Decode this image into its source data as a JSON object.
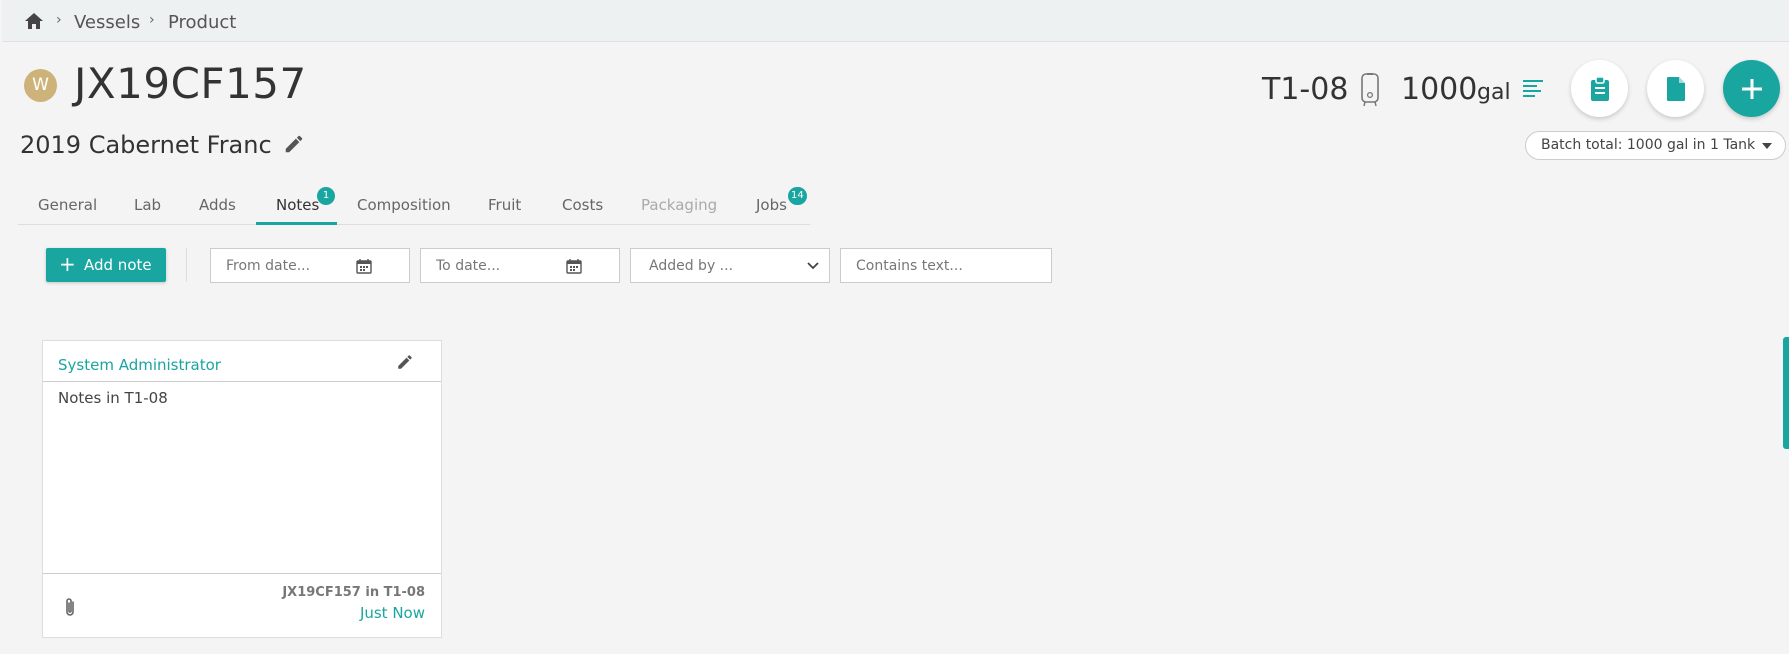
{
  "breadcrumb": {
    "items": [
      "Vessels",
      "Product"
    ]
  },
  "header": {
    "badge_letter": "W",
    "title": "JX19CF157",
    "subtitle": "2019 Cabernet Franc",
    "vessel_code": "T1-08",
    "volume": "1000",
    "unit": "gal",
    "batch_total": "Batch total: 1000 gal in 1 Tank"
  },
  "tabs": [
    {
      "label": "General",
      "state": "normal"
    },
    {
      "label": "Lab",
      "state": "normal"
    },
    {
      "label": "Adds",
      "state": "normal"
    },
    {
      "label": "Notes",
      "state": "active",
      "badge": "1"
    },
    {
      "label": "Composition",
      "state": "normal"
    },
    {
      "label": "Fruit",
      "state": "normal"
    },
    {
      "label": "Costs",
      "state": "normal"
    },
    {
      "label": "Packaging",
      "state": "disabled"
    },
    {
      "label": "Jobs",
      "state": "normal",
      "badge": "14"
    }
  ],
  "toolbar": {
    "add_note_label": "Add note",
    "from_date_placeholder": "From date...",
    "to_date_placeholder": "To date...",
    "added_by_placeholder": "Added by ...",
    "contains_text_placeholder": "Contains text..."
  },
  "note": {
    "author": "System Administrator",
    "text": "Notes in T1-08",
    "reference": "JX19CF157 in T1-08",
    "time": "Just Now"
  },
  "colors": {
    "accent": "#1aa6a0",
    "badge_gold": "#cdb27a",
    "background": "#f4f4f4"
  },
  "icons": [
    "home-icon",
    "pencil-icon",
    "tank-icon",
    "lines-icon",
    "clipboard-icon",
    "document-icon",
    "plus-icon",
    "calendar-icon",
    "chevron-down-icon",
    "edit-icon",
    "paperclip-icon"
  ]
}
